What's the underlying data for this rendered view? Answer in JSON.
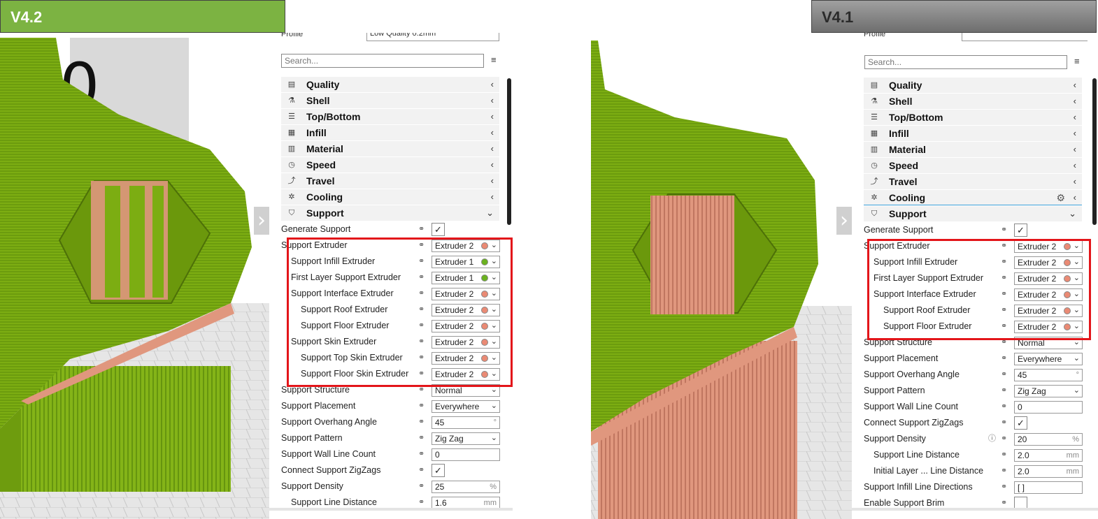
{
  "colors": {
    "model_green": "#7cad12",
    "support_salmon": "#e0977e",
    "extruder1": "#6ab21e",
    "extruder2": "#ea8a74",
    "highlight": "#e3151a",
    "v42_label": "#7cb342",
    "v41_label": "#8a8a8a"
  },
  "labels": {
    "left": "V4.2",
    "right": "V4.1"
  },
  "left_panel": {
    "profile_label": "Profile",
    "profile_value": "Low Quality  0.2mm",
    "search_placeholder": "Search...",
    "categories": [
      {
        "icon": "quality-icon",
        "label": "Quality"
      },
      {
        "icon": "shell-icon",
        "label": "Shell"
      },
      {
        "icon": "top-bottom-icon",
        "label": "Top/Bottom"
      },
      {
        "icon": "infill-icon",
        "label": "Infill"
      },
      {
        "icon": "material-icon",
        "label": "Material"
      },
      {
        "icon": "speed-icon",
        "label": "Speed"
      },
      {
        "icon": "travel-icon",
        "label": "Travel"
      },
      {
        "icon": "cooling-icon",
        "label": "Cooling"
      },
      {
        "icon": "support-icon",
        "label": "Support"
      }
    ],
    "settings": [
      {
        "label": "Generate Support",
        "indent": 0,
        "type": "check",
        "value": "✓"
      },
      {
        "label": "Support Extruder",
        "indent": 0,
        "type": "extruder",
        "value": "Extruder 2",
        "ext": 2
      },
      {
        "label": "Support Infill Extruder",
        "indent": 1,
        "type": "extruder",
        "value": "Extruder 1",
        "ext": 1
      },
      {
        "label": "First Layer Support Extruder",
        "indent": 1,
        "type": "extruder",
        "value": "Extruder 1",
        "ext": 1
      },
      {
        "label": "Support Interface Extruder",
        "indent": 1,
        "type": "extruder",
        "value": "Extruder 2",
        "ext": 2
      },
      {
        "label": "Support Roof Extruder",
        "indent": 2,
        "type": "extruder",
        "value": "Extruder 2",
        "ext": 2
      },
      {
        "label": "Support Floor Extruder",
        "indent": 2,
        "type": "extruder",
        "value": "Extruder 2",
        "ext": 2
      },
      {
        "label": "Support Skin Extruder",
        "indent": 1,
        "type": "extruder",
        "value": "Extruder 2",
        "ext": 2
      },
      {
        "label": "Support Top Skin Extruder",
        "indent": 2,
        "type": "extruder",
        "value": "Extruder 2",
        "ext": 2
      },
      {
        "label": "Support Floor Skin Extruder",
        "indent": 2,
        "type": "extruder",
        "value": "Extruder 2",
        "ext": 2
      },
      {
        "label": "Support Structure",
        "indent": 0,
        "type": "select",
        "value": "Normal"
      },
      {
        "label": "Support Placement",
        "indent": 0,
        "type": "select",
        "value": "Everywhere"
      },
      {
        "label": "Support Overhang Angle",
        "indent": 0,
        "type": "number",
        "value": "45",
        "unit": "°"
      },
      {
        "label": "Support Pattern",
        "indent": 0,
        "type": "select",
        "value": "Zig Zag"
      },
      {
        "label": "Support Wall Line Count",
        "indent": 0,
        "type": "number",
        "value": "0",
        "unit": ""
      },
      {
        "label": "Connect Support ZigZags",
        "indent": 0,
        "type": "check",
        "value": "✓"
      },
      {
        "label": "Support Density",
        "indent": 0,
        "type": "number",
        "value": "25",
        "unit": "%"
      },
      {
        "label": "Support Line Distance",
        "indent": 1,
        "type": "number",
        "value": "1.6",
        "unit": "mm"
      }
    ]
  },
  "right_panel": {
    "profile_label": "Profile",
    "profile_value": "",
    "search_placeholder": "Search...",
    "categories": [
      {
        "icon": "quality-icon",
        "label": "Quality"
      },
      {
        "icon": "shell-icon",
        "label": "Shell"
      },
      {
        "icon": "top-bottom-icon",
        "label": "Top/Bottom"
      },
      {
        "icon": "infill-icon",
        "label": "Infill"
      },
      {
        "icon": "material-icon",
        "label": "Material"
      },
      {
        "icon": "speed-icon",
        "label": "Speed"
      },
      {
        "icon": "travel-icon",
        "label": "Travel"
      },
      {
        "icon": "cooling-icon",
        "label": "Cooling"
      },
      {
        "icon": "support-icon",
        "label": "Support"
      }
    ],
    "settings": [
      {
        "label": "Generate Support",
        "indent": 0,
        "type": "check",
        "value": "✓"
      },
      {
        "label": "Support Extruder",
        "indent": 0,
        "type": "extruder",
        "value": "Extruder 2",
        "ext": 2
      },
      {
        "label": "Support Infill Extruder",
        "indent": 1,
        "type": "extruder",
        "value": "Extruder 2",
        "ext": 2
      },
      {
        "label": "First Layer Support Extruder",
        "indent": 1,
        "type": "extruder",
        "value": "Extruder 2",
        "ext": 2
      },
      {
        "label": "Support Interface Extruder",
        "indent": 1,
        "type": "extruder",
        "value": "Extruder 2",
        "ext": 2
      },
      {
        "label": "Support Roof Extruder",
        "indent": 2,
        "type": "extruder",
        "value": "Extruder 2",
        "ext": 2
      },
      {
        "label": "Support Floor Extruder",
        "indent": 2,
        "type": "extruder",
        "value": "Extruder 2",
        "ext": 2
      },
      {
        "label": "Support Structure",
        "indent": 0,
        "type": "select",
        "value": "Normal"
      },
      {
        "label": "Support Placement",
        "indent": 0,
        "type": "select",
        "value": "Everywhere"
      },
      {
        "label": "Support Overhang Angle",
        "indent": 0,
        "type": "number",
        "value": "45",
        "unit": "°"
      },
      {
        "label": "Support Pattern",
        "indent": 0,
        "type": "select",
        "value": "Zig Zag"
      },
      {
        "label": "Support Wall Line Count",
        "indent": 0,
        "type": "number",
        "value": "0",
        "unit": ""
      },
      {
        "label": "Connect Support ZigZags",
        "indent": 0,
        "type": "check",
        "value": "✓"
      },
      {
        "label": "Support Density",
        "indent": 0,
        "type": "number",
        "value": "20",
        "unit": "%",
        "info": true
      },
      {
        "label": "Support Line Distance",
        "indent": 1,
        "type": "number",
        "value": "2.0",
        "unit": "mm"
      },
      {
        "label": "Initial Layer ... Line Distance",
        "indent": 1,
        "type": "number",
        "value": "2.0",
        "unit": "mm"
      },
      {
        "label": "Support Infill Line Directions",
        "indent": 0,
        "type": "number",
        "value": "[ ]",
        "unit": ""
      },
      {
        "label": "Enable Support Brim",
        "indent": 0,
        "type": "check",
        "value": ""
      }
    ]
  }
}
